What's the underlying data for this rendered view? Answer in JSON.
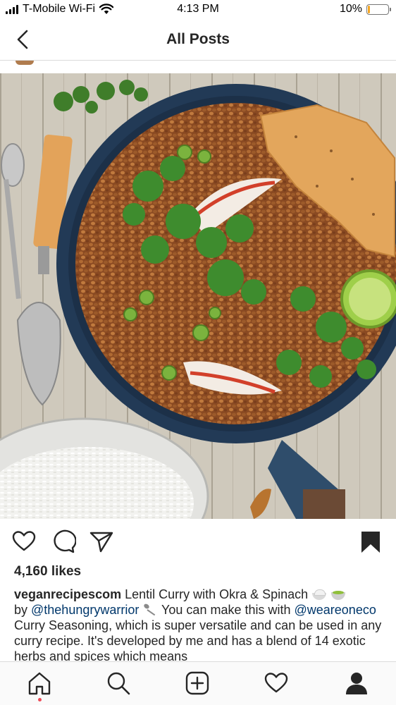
{
  "status_bar": {
    "carrier": "T-Mobile Wi-Fi",
    "time": "4:13 PM",
    "battery_percent": "10%",
    "battery_level": 0.1,
    "battery_color": "#f5a623"
  },
  "header": {
    "title": "All Posts",
    "back_icon": "chevron-left-icon"
  },
  "post": {
    "actions": {
      "like_icon": "heart-icon",
      "comment_icon": "comment-icon",
      "share_icon": "paper-plane-icon",
      "save_icon": "bookmark-filled-icon"
    },
    "likes": "4,160 likes",
    "caption": {
      "username": "veganrecipescom",
      "text_1": " Lentil Curry with Okra & Spinach ",
      "by": " by ",
      "mention_1": "@thehungrywarrior",
      "text_2": " You can make this with ",
      "mention_2": "@weareoneco",
      "text_3": " Curry Seasoning, which is super versatile and can be used in any curry recipe. It's developed by me and has a blend of 14 exotic herbs and spices which means"
    }
  },
  "tab_bar": {
    "items": [
      {
        "icon": "home-icon"
      },
      {
        "icon": "search-icon"
      },
      {
        "icon": "new-post-icon"
      },
      {
        "icon": "activity-heart-icon"
      },
      {
        "icon": "profile-icon"
      }
    ],
    "notification_dot_color": "#ed4956"
  },
  "colors": {
    "text": "#262626",
    "mention": "#00376b",
    "divider": "#dbdbdb"
  }
}
